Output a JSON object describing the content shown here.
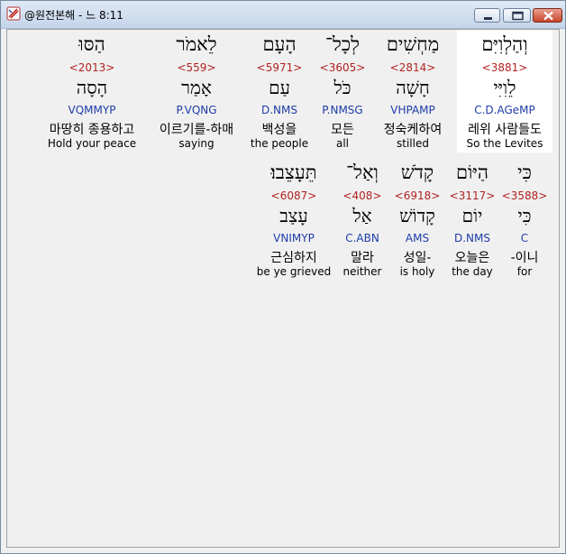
{
  "window": {
    "title": "@원전본해 - 느 8:11"
  },
  "rows": [
    {
      "words": [
        {
          "hebrew": "וְהַלְוִיִּם",
          "strong": "<3881>",
          "lemma": "לֵוִיִּי",
          "morph": "C.D.AGeMP",
          "korean": "레위 사람들도",
          "english": "So the Levites",
          "highlight": true
        },
        {
          "hebrew": "מַחְשִׁים",
          "strong": "<2814>",
          "lemma": "חָשָׁה",
          "morph": "VHPAMP",
          "korean": "정숙케하여",
          "english": "stilled",
          "highlight": false
        },
        {
          "hebrew": "לְכָל־",
          "strong": "<3605>",
          "lemma": "כֹּל",
          "morph": "P.NMSG",
          "korean": "모든",
          "english": "all",
          "highlight": false
        },
        {
          "hebrew": "הָעָם",
          "strong": "<5971>",
          "lemma": "עַם",
          "morph": "D.NMS",
          "korean": "백성을",
          "english": "the people",
          "highlight": false
        },
        {
          "hebrew": "לֵאמֹר",
          "strong": "<559>",
          "lemma": "אָמַר",
          "morph": "P.VQNG",
          "korean": "이르기를-하매",
          "english": "saying",
          "highlight": false
        },
        {
          "hebrew": "הַסּוּ",
          "strong": "<2013>",
          "lemma": "הָסָה",
          "morph": "VQMMYP",
          "korean": "마땅히 종용하고",
          "english": "Hold your peace",
          "highlight": false
        }
      ]
    },
    {
      "words": [
        {
          "hebrew": "כִּי",
          "strong": "<3588>",
          "lemma": "כִּי",
          "morph": "C",
          "korean": "-이니",
          "english": "for",
          "highlight": false
        },
        {
          "hebrew": "הַיּוֹם",
          "strong": "<3117>",
          "lemma": "יוֹם",
          "morph": "D.NMS",
          "korean": "오늘은",
          "english": "the day",
          "highlight": false
        },
        {
          "hebrew": "קָדֹשׁ",
          "strong": "<6918>",
          "lemma": "קָדוֹשׁ",
          "morph": "AMS",
          "korean": "성일-",
          "english": "is holy",
          "highlight": false
        },
        {
          "hebrew": "וְאַל־",
          "strong": "<408>",
          "lemma": "אַל",
          "morph": "C.ABN",
          "korean": "말라",
          "english": "neither",
          "highlight": false
        },
        {
          "hebrew": "תֵּעָצֵבוּ׃",
          "strong": "<6087>",
          "lemma": "עָצַב",
          "morph": "VNIMYP",
          "korean": "근심하지",
          "english": "be ye grieved",
          "highlight": false
        }
      ]
    }
  ]
}
